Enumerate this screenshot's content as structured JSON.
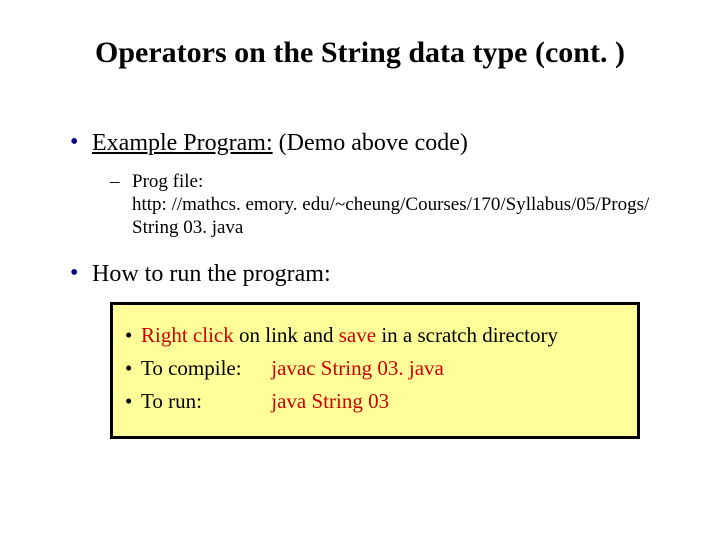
{
  "title": "Operators on the String data type (cont. )",
  "bullets": {
    "example": {
      "label": "Example Program:",
      "after": " (Demo above code)"
    },
    "progfile": {
      "label": "Prog file:",
      "url": "http: //mathcs. emory. edu/~cheung/Courses/170/Syllabus/05/Progs/ String 03. java"
    },
    "howto": "How to run the program:"
  },
  "box": {
    "line1": {
      "a": "Right click",
      "b": " on link and ",
      "c": "save",
      "d": " in a scratch directory"
    },
    "line2": {
      "label": "To compile:",
      "cmd": "javac String 03. java"
    },
    "line3": {
      "label": "To run:",
      "cmd": "java String 03"
    }
  }
}
